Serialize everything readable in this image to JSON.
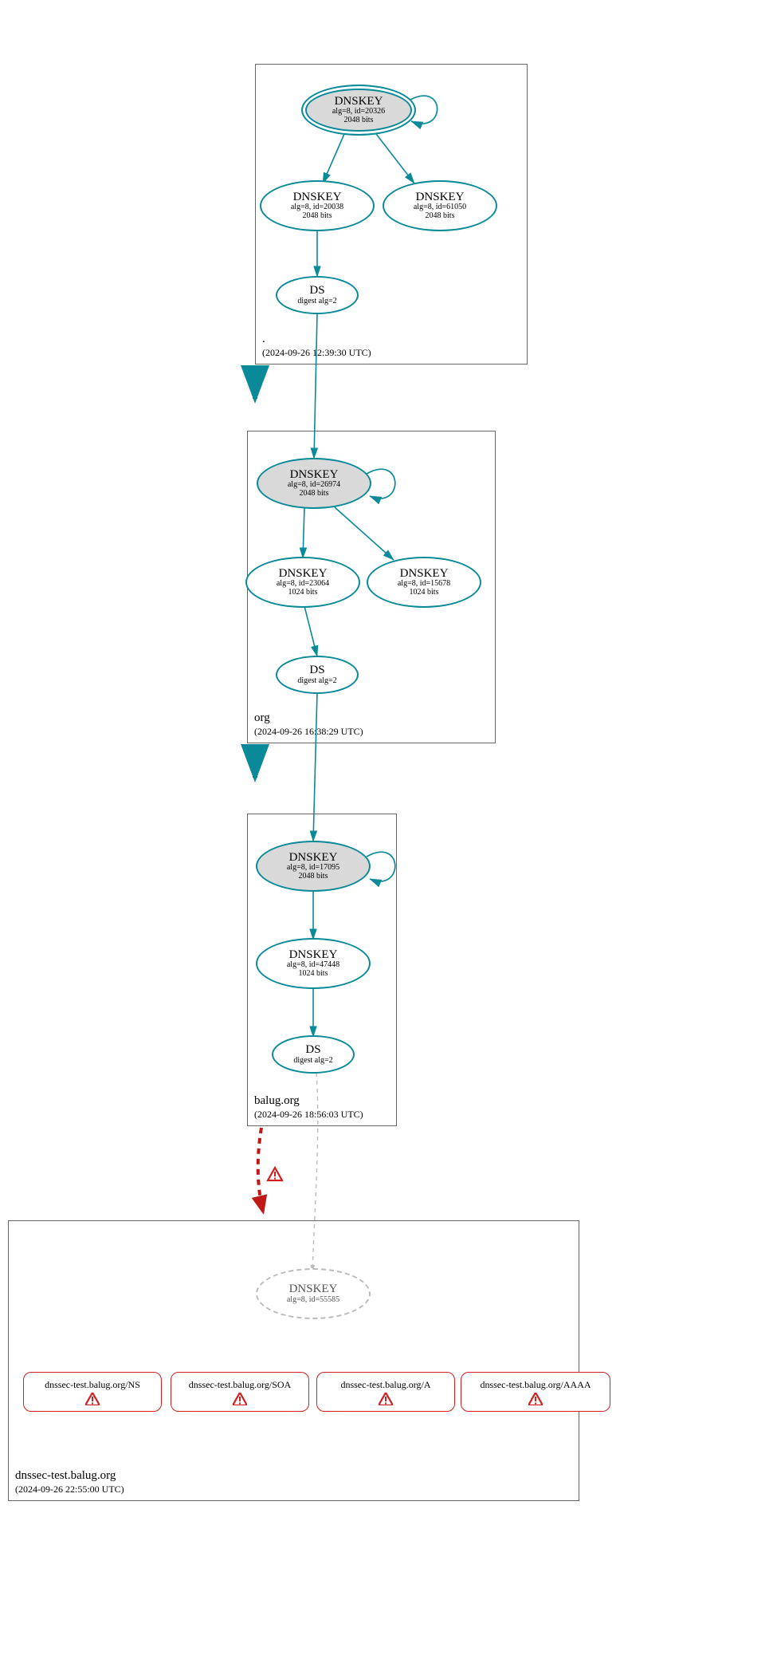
{
  "zones": {
    "root": {
      "name": ".",
      "timestamp": "(2024-09-26 12:39:30 UTC)"
    },
    "org": {
      "name": "org",
      "timestamp": "(2024-09-26 16:38:29 UTC)"
    },
    "balug": {
      "name": "balug.org",
      "timestamp": "(2024-09-26 18:56:03 UTC)"
    },
    "dnssec": {
      "name": "dnssec-test.balug.org",
      "timestamp": "(2024-09-26 22:55:00 UTC)"
    }
  },
  "nodes": {
    "root_ksk": {
      "title": "DNSKEY",
      "alg": "alg=8, id=20326",
      "bits": "2048 bits"
    },
    "root_zsk1": {
      "title": "DNSKEY",
      "alg": "alg=8, id=20038",
      "bits": "2048 bits"
    },
    "root_zsk2": {
      "title": "DNSKEY",
      "alg": "alg=8, id=61050",
      "bits": "2048 bits"
    },
    "root_ds": {
      "title": "DS",
      "alg": "digest alg=2"
    },
    "org_ksk": {
      "title": "DNSKEY",
      "alg": "alg=8, id=26974",
      "bits": "2048 bits"
    },
    "org_zsk1": {
      "title": "DNSKEY",
      "alg": "alg=8, id=23064",
      "bits": "1024 bits"
    },
    "org_zsk2": {
      "title": "DNSKEY",
      "alg": "alg=8, id=15678",
      "bits": "1024 bits"
    },
    "org_ds": {
      "title": "DS",
      "alg": "digest alg=2"
    },
    "balug_ksk": {
      "title": "DNSKEY",
      "alg": "alg=8, id=17095",
      "bits": "2048 bits"
    },
    "balug_zsk": {
      "title": "DNSKEY",
      "alg": "alg=8, id=47448",
      "bits": "1024 bits"
    },
    "balug_ds": {
      "title": "DS",
      "alg": "digest alg=2"
    },
    "dnssec_key": {
      "title": "DNSKEY",
      "alg": "alg=8, id=55585"
    }
  },
  "rr": {
    "ns": "dnssec-test.balug.org/NS",
    "soa": "dnssec-test.balug.org/SOA",
    "a": "dnssec-test.balug.org/A",
    "aaaa": "dnssec-test.balug.org/AAAA"
  }
}
